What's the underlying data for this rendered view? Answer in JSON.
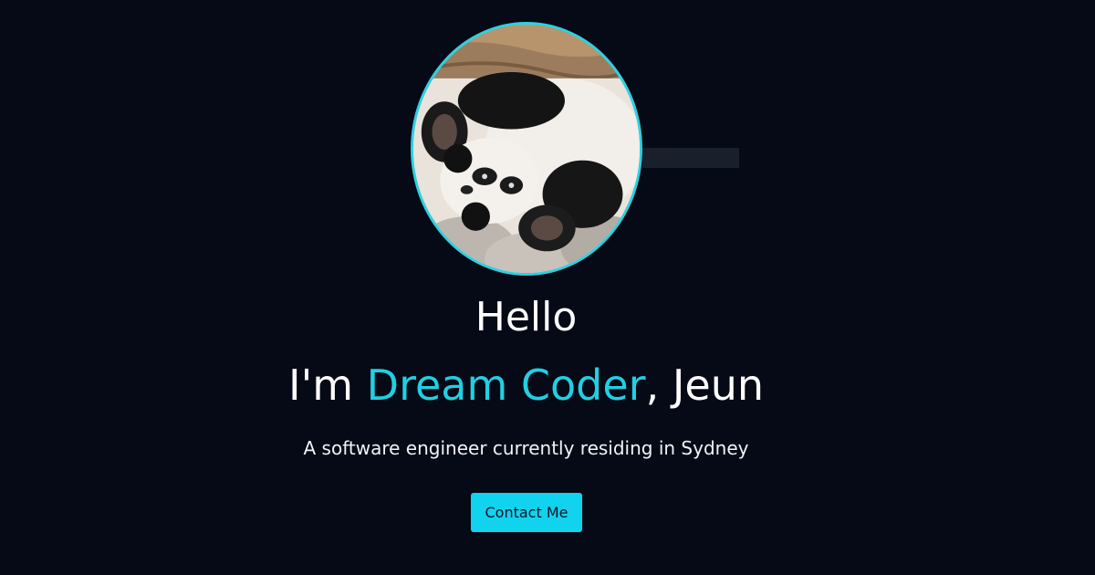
{
  "hero": {
    "greeting": "Hello",
    "intro_prefix": "I'm ",
    "intro_highlight": "Dream Coder",
    "intro_suffix": ", Jeun",
    "subtitle": "A software engineer currently residing in Sydney",
    "cta_label": "Contact Me"
  },
  "avatar": {
    "icon": "panda-photo",
    "border_color": "#2fd0e0"
  },
  "colors": {
    "background": "#050a16",
    "accent": "#22cfe3",
    "button": "#12d3ee"
  }
}
